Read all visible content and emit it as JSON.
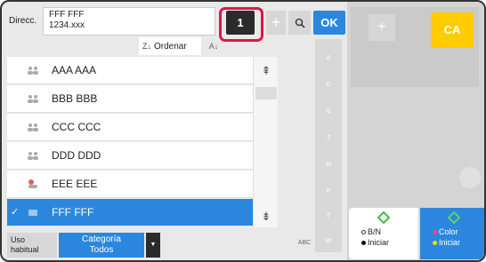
{
  "address": {
    "label": "Direcc.",
    "line1": "FFF FFF",
    "line2": "1234.xxx"
  },
  "toolbar": {
    "count": "1",
    "plus": "+",
    "ok": "OK"
  },
  "sort": {
    "label": "Ordenar"
  },
  "contacts": [
    {
      "name": "AAA AAA",
      "icon": "group-icon"
    },
    {
      "name": "BBB BBB",
      "icon": "group-icon"
    },
    {
      "name": "CCC CCC",
      "icon": "group-icon"
    },
    {
      "name": "DDD DDD",
      "icon": "group-icon"
    },
    {
      "name": "EEE EEE",
      "icon": "contact-group-icon"
    },
    {
      "name": "FFF FFF",
      "icon": "contact-icon",
      "selected": true
    }
  ],
  "alpha_index": [
    "A",
    "D",
    "G",
    "J",
    "M",
    "P",
    "T",
    "W"
  ],
  "bottom": {
    "uso_line1": "Uso",
    "uso_line2": "habitual",
    "cat_line1": "Categoría",
    "cat_line2": "Todos",
    "abc": "ABC"
  },
  "right_panel": {
    "ca": "CA",
    "plus": "+",
    "bw_line1": "B/N",
    "bw_line2": "Iniciar",
    "color_line1": "Color",
    "color_line2": "Iniciar"
  },
  "colors": {
    "accent": "#2b87de",
    "highlight": "#e0154b",
    "ca": "#ffcc00"
  }
}
